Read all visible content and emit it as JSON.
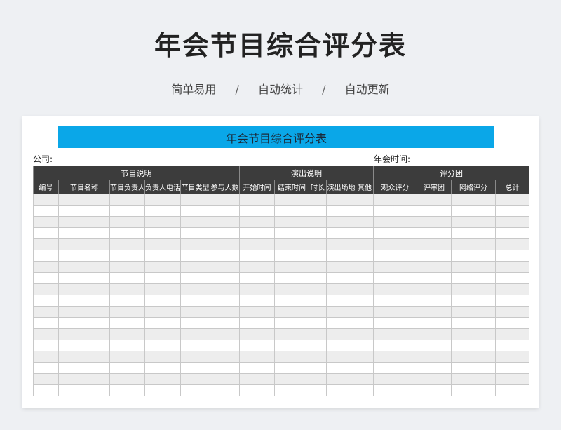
{
  "header": {
    "title": "年会节目综合评分表",
    "features": [
      "简单易用",
      "自动统计",
      "自动更新"
    ],
    "separator": "/"
  },
  "sheet": {
    "banner_title": "年会节目综合评分表",
    "company_label": "公司:",
    "event_time_label": "年会时间:",
    "groups": [
      "节目说明",
      "演出说明",
      "评分团"
    ],
    "columns": [
      "编号",
      "节目名称",
      "节目负责人",
      "负责人电话",
      "节目类型",
      "参与人数",
      "开始时间",
      "结束时间",
      "时长",
      "演出场地",
      "其他",
      "观众评分",
      "评审团",
      "网络评分",
      "总计"
    ],
    "colors": {
      "banner": "#0aa7e8",
      "header_bg": "#3c3c3c",
      "stripe": "#ededed"
    }
  }
}
